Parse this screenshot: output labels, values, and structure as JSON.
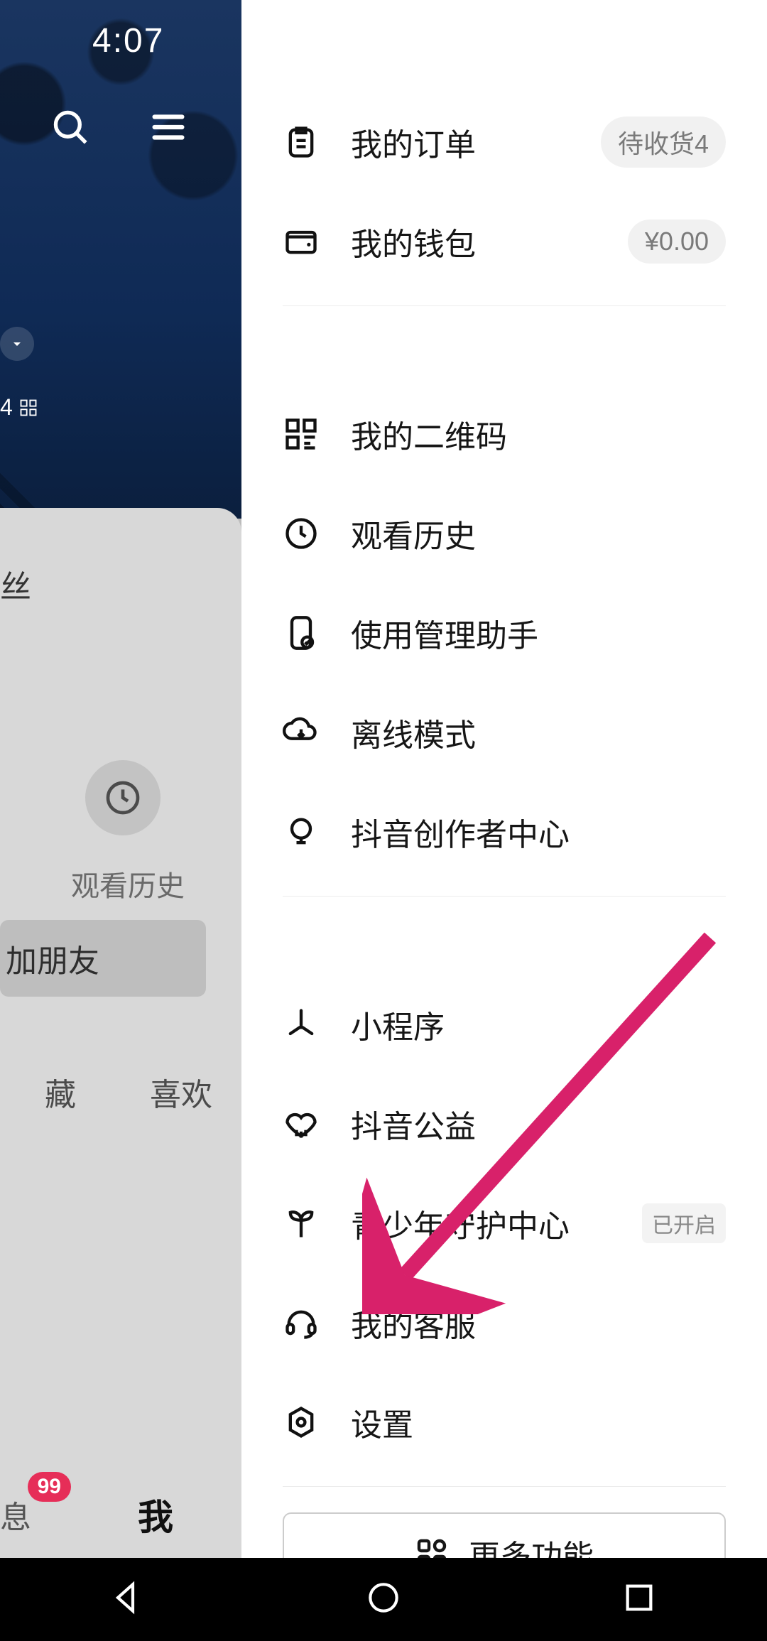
{
  "status": {
    "time": "4:07"
  },
  "bg": {
    "fans_partial": "丝",
    "small_num": "4",
    "history_label": "观看历史",
    "add_friend": "加朋友",
    "tab_fav": "藏",
    "tab_like": "喜欢",
    "nav_msg": "息",
    "nav_badge": "99",
    "nav_me": "我"
  },
  "drawer": {
    "items": [
      {
        "id": "orders",
        "label": "我的订单",
        "badge": "待收货4",
        "badge_kind": "pill"
      },
      {
        "id": "wallet",
        "label": "我的钱包",
        "badge": "¥0.00",
        "badge_kind": "pill"
      }
    ],
    "group2": [
      {
        "id": "qrcode",
        "label": "我的二维码"
      },
      {
        "id": "history",
        "label": "观看历史"
      },
      {
        "id": "usage",
        "label": "使用管理助手"
      },
      {
        "id": "offline",
        "label": "离线模式"
      },
      {
        "id": "creator",
        "label": "抖音创作者中心"
      }
    ],
    "group3": [
      {
        "id": "miniapp",
        "label": "小程序"
      },
      {
        "id": "charity",
        "label": "抖音公益"
      },
      {
        "id": "teen",
        "label": "青少年守护中心",
        "badge": "已开启",
        "badge_kind": "text"
      },
      {
        "id": "service",
        "label": "我的客服"
      },
      {
        "id": "settings",
        "label": "设置"
      }
    ],
    "more_label": "更多功能"
  }
}
